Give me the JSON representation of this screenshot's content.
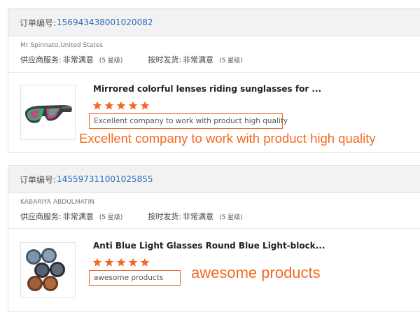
{
  "labels": {
    "order_no": "订单编号:",
    "supplier_service": "供应商服务:",
    "on_time_shipping": "按时发货:"
  },
  "colors": {
    "accent_link": "#2a6ebb",
    "annotation_orange": "#f26a22",
    "star_orange": "#f26a22",
    "header_bg": "#f2f2f2"
  },
  "orders": [
    {
      "order_number": "15694343800102008​2",
      "buyer": "Mr Spinnato,United States",
      "supplier_service_value": "非常满意",
      "supplier_service_level": "(5 星级)",
      "shipping_value": "非常满意",
      "shipping_level": "(5 星级)",
      "product_title": "Mirrored colorful lenses riding sunglasses for ...",
      "star_rating": 5,
      "review_text": "Excellent company to work with product high quality",
      "annotation": "Excellent company to work with product high quality"
    },
    {
      "order_number": "1455973110010258​55",
      "buyer": "KABARIYA ABDULMATIN",
      "supplier_service_value": "非常满意",
      "supplier_service_level": "(5 星级)",
      "shipping_value": "非常满意",
      "shipping_level": "(5 星级)",
      "product_title": "Anti Blue Light Glasses Round Blue Light-block...",
      "star_rating": 5,
      "review_text": "awesome products",
      "annotation": "awesome products"
    }
  ]
}
